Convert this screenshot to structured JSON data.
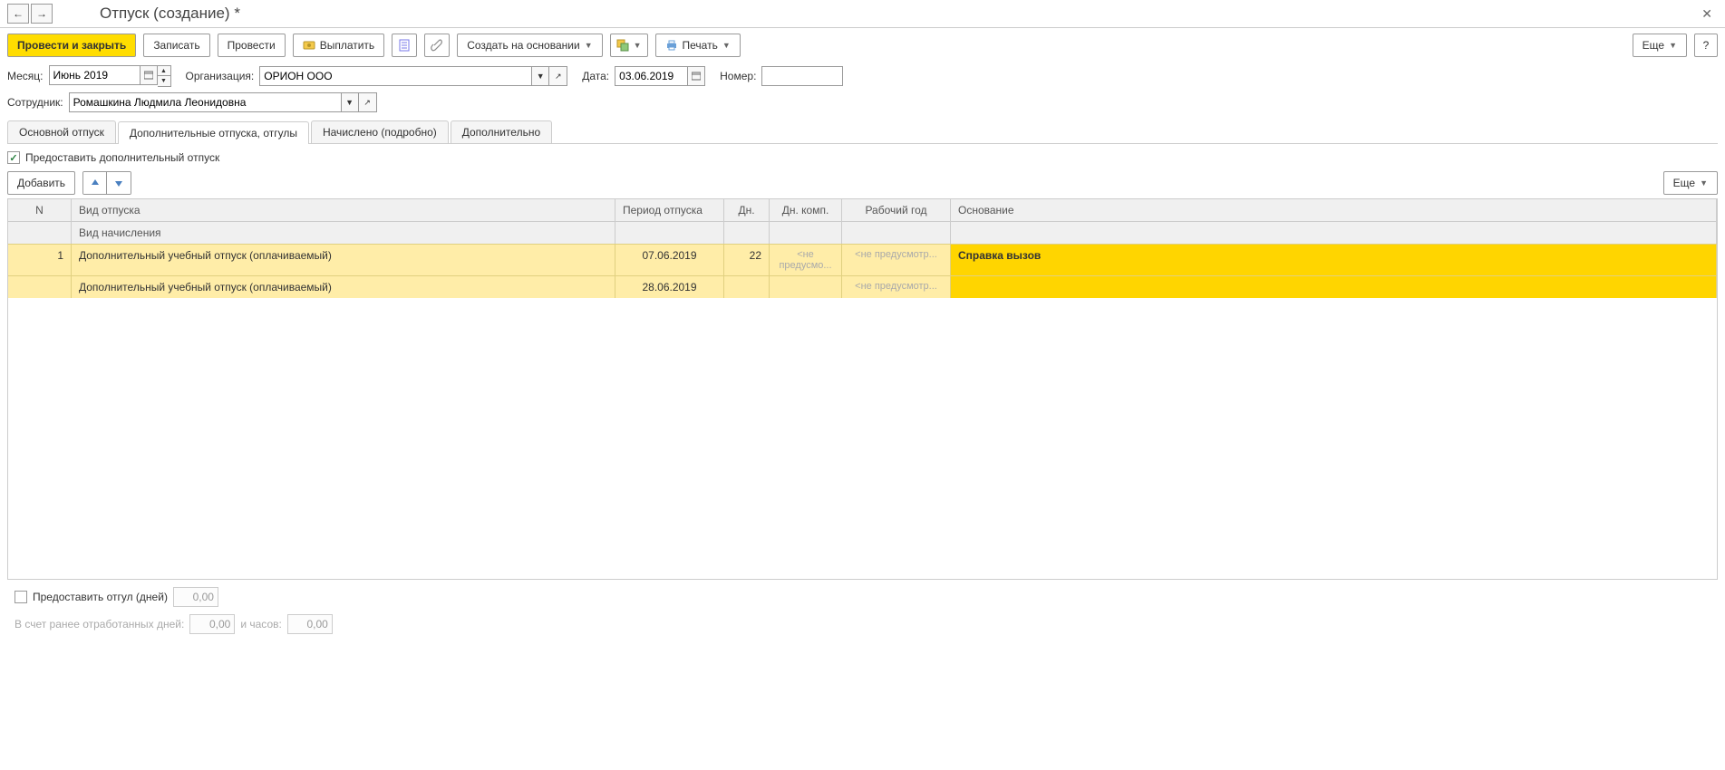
{
  "title": "Отпуск (создание) *",
  "nav": {
    "back": "←",
    "forward": "→"
  },
  "toolbar": {
    "post_close": "Провести и закрыть",
    "write": "Записать",
    "post": "Провести",
    "pay": "Выплатить",
    "create_based": "Создать на основании",
    "print": "Печать",
    "more": "Еще",
    "help": "?"
  },
  "fields": {
    "month_label": "Месяц:",
    "month_value": "Июнь 2019",
    "org_label": "Организация:",
    "org_value": "ОРИОН ООО",
    "date_label": "Дата:",
    "date_value": "03.06.2019",
    "number_label": "Номер:",
    "number_value": "",
    "employee_label": "Сотрудник:",
    "employee_value": "Ромашкина Людмила Леонидовна"
  },
  "tabs": {
    "main": "Основной отпуск",
    "additional": "Дополнительные отпуска, отгулы",
    "accrued": "Начислено (подробно)",
    "extra": "Дополнительно"
  },
  "additional_tab": {
    "provide_checkbox": "Предоставить дополнительный отпуск",
    "add_btn": "Добавить",
    "more": "Еще",
    "columns": {
      "n": "N",
      "type": "Вид отпуска",
      "accrual": "Вид начисления",
      "period": "Период отпуска",
      "days": "Дн.",
      "days_comp": "Дн. комп.",
      "work_year": "Рабочий год",
      "basis": "Основание"
    },
    "rows": [
      {
        "n": "1",
        "type": "Дополнительный учебный отпуск (оплачиваемый)",
        "accrual": "Дополнительный учебный отпуск (оплачиваемый)",
        "period_from": "07.06.2019",
        "period_to": "28.06.2019",
        "days": "22",
        "days_comp": "<не предусмо...",
        "work_year1": "<не предусмотр...",
        "work_year2": "<не предусмотр...",
        "basis": "Справка вызов"
      }
    ]
  },
  "footer": {
    "provide_timeoff": "Предоставить отгул (дней)",
    "timeoff_days": "0,00",
    "prev_days_label": "В счет ранее отработанных дней:",
    "prev_days": "0,00",
    "hours_label": "и часов:",
    "hours": "0,00"
  }
}
